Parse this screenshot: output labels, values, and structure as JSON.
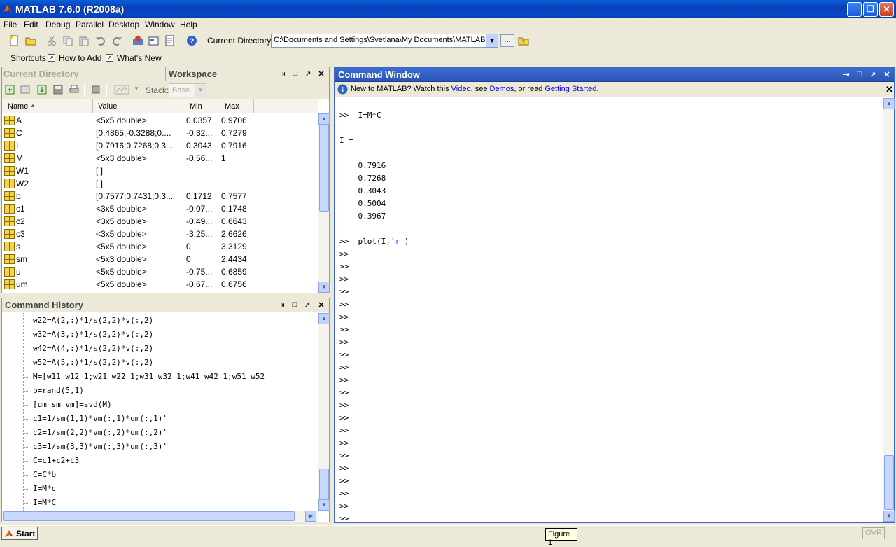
{
  "window": {
    "title": "MATLAB  7.6.0 (R2008a)"
  },
  "menu": [
    "File",
    "Edit",
    "Debug",
    "Parallel",
    "Desktop",
    "Window",
    "Help"
  ],
  "toolbar": {
    "current_directory_label": "Current Directory:",
    "current_directory_value": "C:\\Documents and Settings\\Svetlana\\My Documents\\MATLAB",
    "browse_label": "..."
  },
  "shortcuts": {
    "shortcuts_label": "Shortcuts",
    "how_to_add": "How to Add",
    "whats_new": "What's New"
  },
  "workspace": {
    "tab_current_directory": "Current Directory",
    "tab_workspace": "Workspace",
    "stack_label": "Stack:",
    "stack_value": "Base",
    "columns": [
      "Name",
      "Value",
      "Min",
      "Max"
    ],
    "rows": [
      {
        "name": "A",
        "value": "<5x5 double>",
        "min": "0.0357",
        "max": "0.9706"
      },
      {
        "name": "C",
        "value": "[0.4865;-0.3288;0....",
        "min": "-0.32...",
        "max": "0.7279"
      },
      {
        "name": "I",
        "value": "[0.7916;0.7268;0.3...",
        "min": "0.3043",
        "max": "0.7916"
      },
      {
        "name": "M",
        "value": "<5x3 double>",
        "min": "-0.56...",
        "max": "1"
      },
      {
        "name": "W1",
        "value": "[ ]",
        "min": "",
        "max": ""
      },
      {
        "name": "W2",
        "value": "[ ]",
        "min": "",
        "max": ""
      },
      {
        "name": "b",
        "value": "[0.7577;0.7431;0.3...",
        "min": "0.1712",
        "max": "0.7577"
      },
      {
        "name": "c1",
        "value": "<3x5 double>",
        "min": "-0.07...",
        "max": "0.1748"
      },
      {
        "name": "c2",
        "value": "<3x5 double>",
        "min": "-0.49...",
        "max": "0.6643"
      },
      {
        "name": "c3",
        "value": "<3x5 double>",
        "min": "-3.25...",
        "max": "2.6626"
      },
      {
        "name": "s",
        "value": "<5x5 double>",
        "min": "0",
        "max": "3.3129"
      },
      {
        "name": "sm",
        "value": "<5x3 double>",
        "min": "0",
        "max": "2.4434"
      },
      {
        "name": "u",
        "value": "<5x5 double>",
        "min": "-0.75...",
        "max": "0.6859"
      },
      {
        "name": "um",
        "value": "<5x5 double>",
        "min": "-0.67...",
        "max": "0.6756"
      }
    ]
  },
  "history": {
    "title": "Command History",
    "lines": [
      "w22=A(2,:)*1/s(2,2)*v(:,2)",
      "w32=A(3,:)*1/s(2,2)*v(:,2)",
      "w42=A(4,:)*1/s(2,2)*v(:,2)",
      "w52=A(5,:)*1/s(2,2)*v(:,2)",
      "M=[w11 w12 1;w21 w22 1;w31 w32 1;w41 w42 1;w51 w52",
      "b=rand(5,1)",
      "[um sm vm]=svd(M)",
      "c1=1/sm(1,1)*vm(:,1)*um(:,1)'",
      "c2=1/sm(2,2)*vm(:,2)*um(:,2)'",
      "c3=1/sm(3,3)*vm(:,3)*um(:,3)'",
      "C=c1+c2+c3",
      "C=C*b",
      "I=M*c",
      "I=M*C"
    ]
  },
  "command_window": {
    "title": "Command Window",
    "info_prefix": "New to MATLAB? Watch this ",
    "info_video": "Video",
    "info_mid1": ", see ",
    "info_demos": "Demos",
    "info_mid2": ", or read ",
    "info_getting_started": "Getting Started",
    "info_suffix": ".",
    "lines": [
      ">>  I=M*C",
      "",
      "I =",
      "",
      "    0.7916",
      "    0.7268",
      "    0.3043",
      "    0.5004",
      "    0.3967",
      "",
      ">>  plot(I,'r')",
      ">>",
      ">>",
      ">>",
      ">>",
      ">>",
      ">>",
      ">>",
      ">>",
      ">>",
      ">>",
      ">>",
      ">>",
      ">>",
      ">>",
      ">>",
      ">>",
      ">>",
      ">>",
      ">>",
      ">>",
      ">>",
      ">>"
    ]
  },
  "taskbar": {
    "start_label": "Start",
    "figure_button": "Figure 1",
    "ovr": "OVR"
  }
}
